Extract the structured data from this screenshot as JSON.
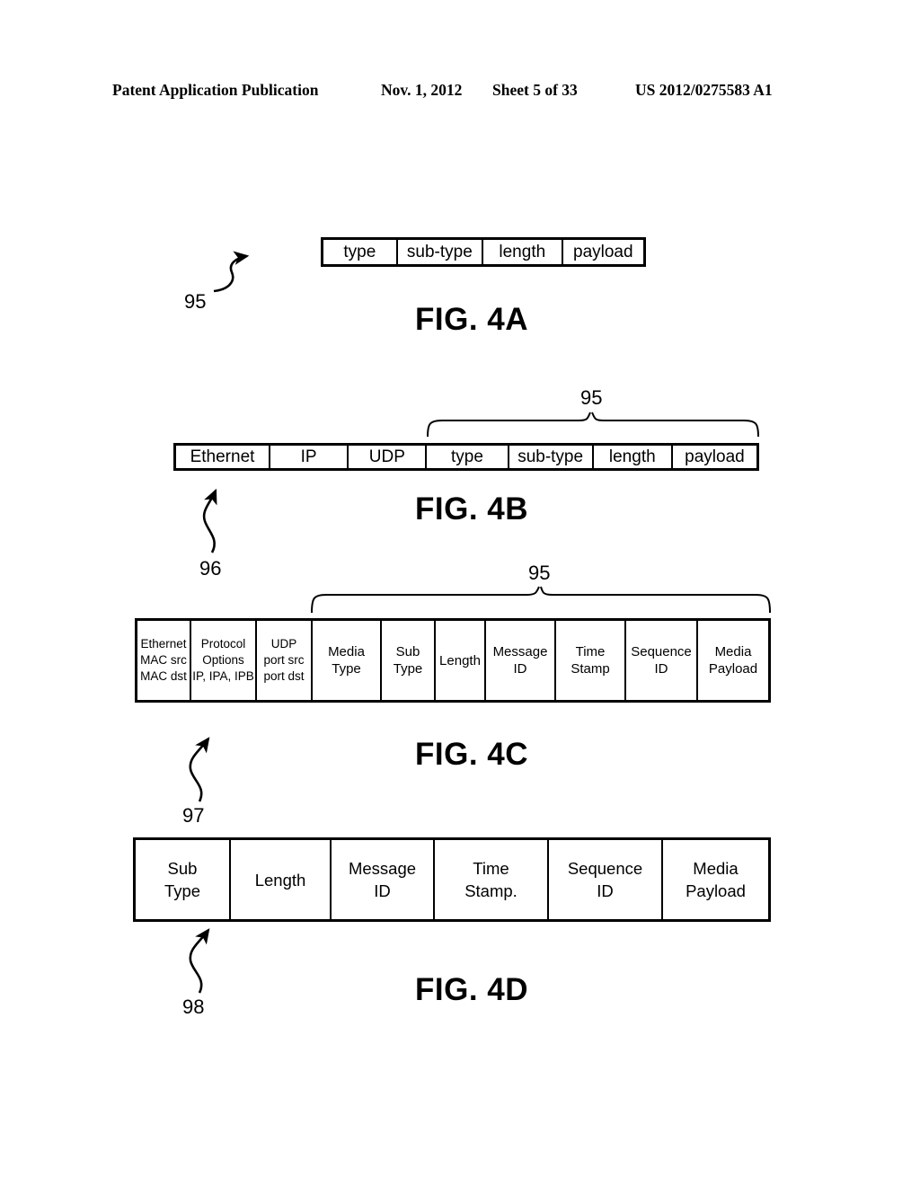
{
  "header": {
    "title": "Patent Application Publication",
    "date": "Nov. 1, 2012",
    "sheet": "Sheet 5 of 33",
    "patent_number": "US 2012/0275583 A1"
  },
  "figures": [
    {
      "caption": "FIG. 4A",
      "ref_label": "95",
      "brace_label": null,
      "cells": [
        {
          "lines": [
            "type"
          ]
        },
        {
          "lines": [
            "sub-type"
          ]
        },
        {
          "lines": [
            "length"
          ]
        },
        {
          "lines": [
            "payload"
          ]
        }
      ]
    },
    {
      "caption": "FIG. 4B",
      "ref_label": "96",
      "brace_label": "95",
      "cells": [
        {
          "lines": [
            "Ethernet"
          ]
        },
        {
          "lines": [
            "IP"
          ]
        },
        {
          "lines": [
            "UDP"
          ]
        },
        {
          "lines": [
            "type"
          ]
        },
        {
          "lines": [
            "sub-type"
          ]
        },
        {
          "lines": [
            "length"
          ]
        },
        {
          "lines": [
            "payload"
          ]
        }
      ]
    },
    {
      "caption": "FIG. 4C",
      "ref_label": "97",
      "brace_label": "95",
      "cells": [
        {
          "lines": [
            "Ethernet",
            "MAC src",
            "MAC dst"
          ]
        },
        {
          "lines": [
            "Protocol",
            "Options",
            "IP, IPA, IPB"
          ]
        },
        {
          "lines": [
            "UDP",
            "port src",
            "port dst"
          ]
        },
        {
          "lines": [
            "Media",
            "Type"
          ]
        },
        {
          "lines": [
            "Sub",
            "Type"
          ]
        },
        {
          "lines": [
            "Length"
          ]
        },
        {
          "lines": [
            "Message",
            "ID"
          ]
        },
        {
          "lines": [
            "Time",
            "Stamp"
          ]
        },
        {
          "lines": [
            "Sequence",
            "ID"
          ]
        },
        {
          "lines": [
            "Media",
            "Payload"
          ]
        }
      ]
    },
    {
      "caption": "FIG. 4D",
      "ref_label": "98",
      "brace_label": null,
      "cells": [
        {
          "lines": [
            "Sub",
            "Type"
          ]
        },
        {
          "lines": [
            "Length"
          ]
        },
        {
          "lines": [
            "Message",
            "ID"
          ]
        },
        {
          "lines": [
            "Time",
            "Stamp."
          ]
        },
        {
          "lines": [
            "Sequence",
            "ID"
          ]
        },
        {
          "lines": [
            "Media",
            "Payload"
          ]
        }
      ]
    }
  ],
  "colors": {
    "ink": "#000000",
    "paper": "#ffffff"
  }
}
